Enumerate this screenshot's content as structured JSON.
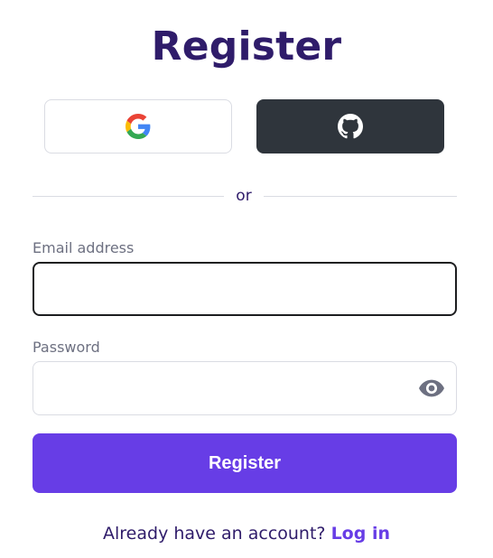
{
  "page": {
    "title": "Register"
  },
  "social": {
    "google_icon": "google-g-icon",
    "github_icon": "github-octocat-icon"
  },
  "divider": {
    "text": "or"
  },
  "form": {
    "email_label": "Email address",
    "email_value": "",
    "password_label": "Password",
    "password_value": "",
    "password_toggle_icon": "eye-icon",
    "submit_label": "Register"
  },
  "footer": {
    "prompt": "Already have an account?",
    "link_label": "Log in"
  },
  "colors": {
    "title": "#2f1c6a",
    "accent": "#673de6",
    "github_bg": "#2f353c",
    "border": "#dadce3",
    "focus_border": "#1d1e20",
    "label": "#6d7081"
  }
}
